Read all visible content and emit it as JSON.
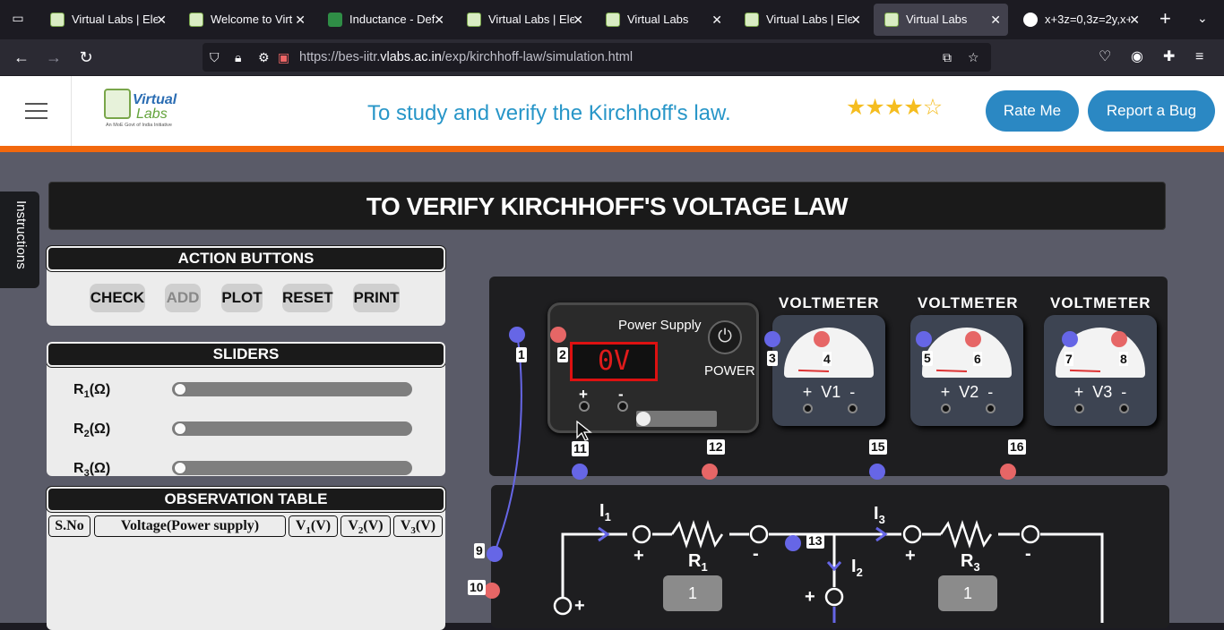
{
  "browser": {
    "tabs": [
      {
        "title": "Virtual Labs | Ele",
        "favicon": "vlabs-icon"
      },
      {
        "title": "Welcome to Virt",
        "favicon": "vlabs-icon"
      },
      {
        "title": "Inductance - Def",
        "favicon": "gfg-icon"
      },
      {
        "title": "Virtual Labs | Ele",
        "favicon": "vlabs-icon"
      },
      {
        "title": "Virtual Labs",
        "favicon": "vlabs-icon"
      },
      {
        "title": "Virtual Labs | Ele",
        "favicon": "vlabs-icon"
      },
      {
        "title": "Virtual Labs",
        "favicon": "vlabs-icon",
        "active": true
      },
      {
        "title": "x+3z=0,3z=2y,x+",
        "favicon": "google-icon"
      }
    ],
    "url_prefix": "https://bes-iitr.",
    "url_domain": "vlabs.ac.in",
    "url_path": "/exp/kirchhoff-law/simulation.html"
  },
  "header": {
    "logo_top": "Virtual",
    "logo_bottom": "Labs",
    "logo_sub": "An MoE Govt of India Initiative",
    "experiment_title": "To study and verify the Kirchhoff's law.",
    "rating": 4,
    "rating_max": 5,
    "rate_button": "Rate Me",
    "bug_button": "Report a Bug"
  },
  "instructions_tab": "Instructions",
  "sim_title": "TO VERIFY KIRCHHOFF'S VOLTAGE LAW",
  "actions": {
    "heading": "ACTION BUTTONS",
    "check": "CHECK",
    "add": "ADD",
    "plot": "PLOT",
    "reset": "RESET",
    "print": "PRINT"
  },
  "sliders": {
    "heading": "SLIDERS",
    "r1": {
      "label": "R",
      "sub": "1",
      "unit": "(Ω)"
    },
    "r2": {
      "label": "R",
      "sub": "2",
      "unit": "(Ω)"
    },
    "r3": {
      "label": "R",
      "sub": "3",
      "unit": "(Ω)"
    }
  },
  "table": {
    "heading": "OBSERVATION TABLE",
    "col_sno": "S.No",
    "col_vps": "Voltage(Power supply)",
    "col_v1": {
      "main": "V",
      "sub": "1",
      "unit": "(V)"
    },
    "col_v2": {
      "main": "V",
      "sub": "2",
      "unit": "(V)"
    },
    "col_v3": {
      "main": "V",
      "sub": "3",
      "unit": "(V)"
    }
  },
  "power_supply": {
    "title": "Power Supply",
    "display": "0V",
    "power_label": "POWER",
    "plus": "+",
    "minus": "-"
  },
  "voltmeters": [
    {
      "title": "VOLTMETER",
      "label": "V1",
      "plus": "+",
      "minus": "-"
    },
    {
      "title": "VOLTMETER",
      "label": "V2",
      "plus": "+",
      "minus": "-"
    },
    {
      "title": "VOLTMETER",
      "label": "V3",
      "plus": "+",
      "minus": "-"
    }
  ],
  "terminals": [
    "1",
    "2",
    "3",
    "4",
    "5",
    "6",
    "7",
    "8",
    "9",
    "10",
    "11",
    "12",
    "13",
    "15",
    "16"
  ],
  "circuit": {
    "i1": {
      "main": "I",
      "sub": "1"
    },
    "i2": {
      "main": "I",
      "sub": "2"
    },
    "i3": {
      "main": "I",
      "sub": "3"
    },
    "r1": {
      "main": "R",
      "sub": "1"
    },
    "r3": {
      "main": "R",
      "sub": "3"
    },
    "r1_value": "1",
    "r3_value": "1",
    "plus": "+",
    "minus": "-"
  },
  "colors": {
    "accent_blue": "#2b88c3",
    "orange_bar": "#f2680d",
    "wire_blue": "#6666e6",
    "wire_red": "#e66666",
    "display_red": "#e01b1b"
  }
}
